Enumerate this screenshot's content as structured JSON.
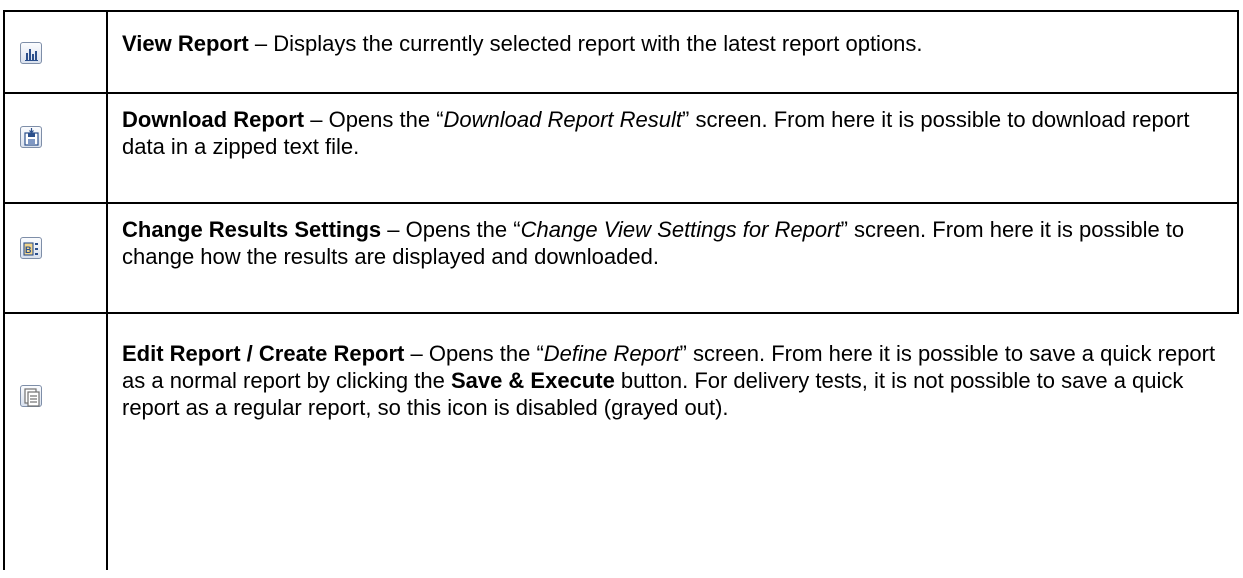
{
  "rows": [
    {
      "icon": "bar-chart-icon",
      "title": "View Report",
      "sep": " – ",
      "text": "Displays the currently selected report with the latest report options."
    },
    {
      "icon": "download-disk-icon",
      "title": "Download Report",
      "sep": " – ",
      "pre": "Opens the “",
      "screen": "Download Report Result",
      "post": "” screen. From here it is possible to download report data in a zipped text file."
    },
    {
      "icon": "settings-grid-icon",
      "title": "Change Results Settings",
      "sep": " – ",
      "pre": "Opens the “",
      "screen": "Change View Settings for Report",
      "post": "” screen. From here it is possible to change how the results are displayed and downloaded."
    },
    {
      "icon": "edit-document-icon",
      "title": "Edit Report / Create Report",
      "sep": " – ",
      "pre": "Opens the “",
      "screen": "Define Report",
      "mid": "” screen. From here it is possible to save a quick report as a normal report by clicking the ",
      "button": "Save & Execute",
      "post": " button. For delivery tests, it is not possible to save a quick report as a regular report, so this icon is disabled (grayed out)."
    }
  ]
}
